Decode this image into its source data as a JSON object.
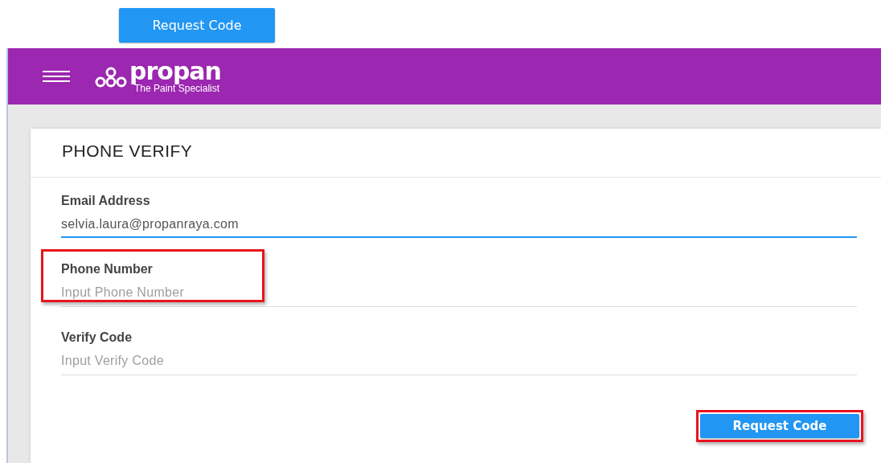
{
  "top_button": {
    "label": "Request Code"
  },
  "app_bar": {
    "logo": {
      "name": "propan",
      "tagline": "The Paint Specialist"
    }
  },
  "card": {
    "title": "PHONE VERIFY",
    "fields": [
      {
        "label": "Email Address",
        "value": "selvia.laura@propanraya.com",
        "focused": true,
        "highlighted": false
      },
      {
        "label": "Phone Number",
        "placeholder": "Input Phone Number",
        "focused": false,
        "highlighted": true
      },
      {
        "label": "Verify Code",
        "placeholder": "Input Verify Code",
        "focused": false,
        "highlighted": false
      }
    ],
    "button": {
      "label": "Request Code",
      "highlighted": true
    }
  }
}
